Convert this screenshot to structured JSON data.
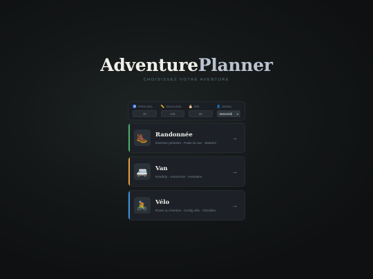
{
  "brand": {
    "part1": "Adventure",
    "part2": "Planner"
  },
  "tagline": "CHOISISSEZ VOTRE AVENTURE",
  "params": [
    {
      "icon": "♿",
      "label": "Poids (kg)",
      "value": "75"
    },
    {
      "icon": "📏",
      "label": "Taille (cm)",
      "value": "175"
    },
    {
      "icon": "🎂",
      "label": "Âge",
      "value": "30"
    },
    {
      "icon": "👤",
      "label": "Niveau",
      "value": "Intermédi",
      "chevron": "▾"
    }
  ],
  "cards": [
    {
      "icon": "🥾",
      "icon_name": "hiking-boot-icon",
      "title": "Randonnée",
      "subtitle": "Itinéraire pédestre · Poids du sac · Matériel",
      "arrow": "→",
      "accent": "#4caf6a"
    },
    {
      "icon": "🚐",
      "icon_name": "van-icon",
      "title": "Van",
      "subtitle": "Roadtrip · Autonomie · Inventaire",
      "arrow": "→",
      "accent": "#e39b3c"
    },
    {
      "icon": "🚴",
      "icon_name": "cyclist-icon",
      "title": "Vélo",
      "subtitle": "Route ou chemins · Config vélo · Checklist",
      "arrow": "→",
      "accent": "#3f8fd9"
    }
  ]
}
